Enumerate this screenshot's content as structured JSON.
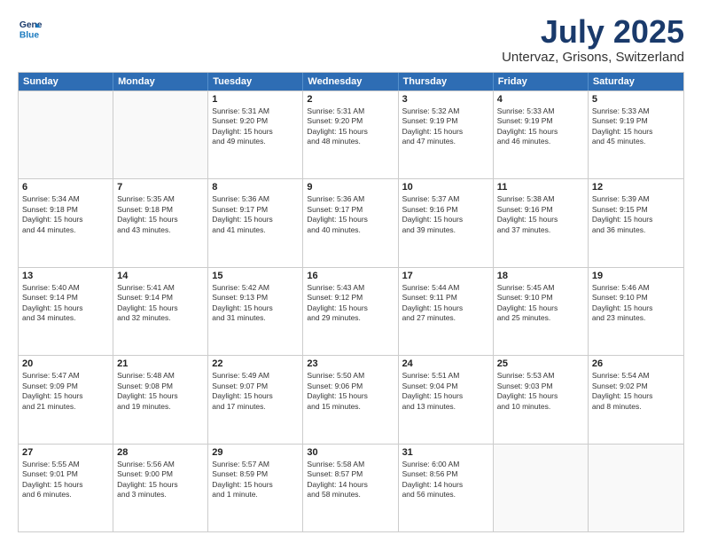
{
  "header": {
    "logo_line1": "General",
    "logo_line2": "Blue",
    "month": "July 2025",
    "location": "Untervaz, Grisons, Switzerland"
  },
  "weekdays": [
    "Sunday",
    "Monday",
    "Tuesday",
    "Wednesday",
    "Thursday",
    "Friday",
    "Saturday"
  ],
  "rows": [
    [
      {
        "day": "",
        "lines": []
      },
      {
        "day": "",
        "lines": []
      },
      {
        "day": "1",
        "lines": [
          "Sunrise: 5:31 AM",
          "Sunset: 9:20 PM",
          "Daylight: 15 hours",
          "and 49 minutes."
        ]
      },
      {
        "day": "2",
        "lines": [
          "Sunrise: 5:31 AM",
          "Sunset: 9:20 PM",
          "Daylight: 15 hours",
          "and 48 minutes."
        ]
      },
      {
        "day": "3",
        "lines": [
          "Sunrise: 5:32 AM",
          "Sunset: 9:19 PM",
          "Daylight: 15 hours",
          "and 47 minutes."
        ]
      },
      {
        "day": "4",
        "lines": [
          "Sunrise: 5:33 AM",
          "Sunset: 9:19 PM",
          "Daylight: 15 hours",
          "and 46 minutes."
        ]
      },
      {
        "day": "5",
        "lines": [
          "Sunrise: 5:33 AM",
          "Sunset: 9:19 PM",
          "Daylight: 15 hours",
          "and 45 minutes."
        ]
      }
    ],
    [
      {
        "day": "6",
        "lines": [
          "Sunrise: 5:34 AM",
          "Sunset: 9:18 PM",
          "Daylight: 15 hours",
          "and 44 minutes."
        ]
      },
      {
        "day": "7",
        "lines": [
          "Sunrise: 5:35 AM",
          "Sunset: 9:18 PM",
          "Daylight: 15 hours",
          "and 43 minutes."
        ]
      },
      {
        "day": "8",
        "lines": [
          "Sunrise: 5:36 AM",
          "Sunset: 9:17 PM",
          "Daylight: 15 hours",
          "and 41 minutes."
        ]
      },
      {
        "day": "9",
        "lines": [
          "Sunrise: 5:36 AM",
          "Sunset: 9:17 PM",
          "Daylight: 15 hours",
          "and 40 minutes."
        ]
      },
      {
        "day": "10",
        "lines": [
          "Sunrise: 5:37 AM",
          "Sunset: 9:16 PM",
          "Daylight: 15 hours",
          "and 39 minutes."
        ]
      },
      {
        "day": "11",
        "lines": [
          "Sunrise: 5:38 AM",
          "Sunset: 9:16 PM",
          "Daylight: 15 hours",
          "and 37 minutes."
        ]
      },
      {
        "day": "12",
        "lines": [
          "Sunrise: 5:39 AM",
          "Sunset: 9:15 PM",
          "Daylight: 15 hours",
          "and 36 minutes."
        ]
      }
    ],
    [
      {
        "day": "13",
        "lines": [
          "Sunrise: 5:40 AM",
          "Sunset: 9:14 PM",
          "Daylight: 15 hours",
          "and 34 minutes."
        ]
      },
      {
        "day": "14",
        "lines": [
          "Sunrise: 5:41 AM",
          "Sunset: 9:14 PM",
          "Daylight: 15 hours",
          "and 32 minutes."
        ]
      },
      {
        "day": "15",
        "lines": [
          "Sunrise: 5:42 AM",
          "Sunset: 9:13 PM",
          "Daylight: 15 hours",
          "and 31 minutes."
        ]
      },
      {
        "day": "16",
        "lines": [
          "Sunrise: 5:43 AM",
          "Sunset: 9:12 PM",
          "Daylight: 15 hours",
          "and 29 minutes."
        ]
      },
      {
        "day": "17",
        "lines": [
          "Sunrise: 5:44 AM",
          "Sunset: 9:11 PM",
          "Daylight: 15 hours",
          "and 27 minutes."
        ]
      },
      {
        "day": "18",
        "lines": [
          "Sunrise: 5:45 AM",
          "Sunset: 9:10 PM",
          "Daylight: 15 hours",
          "and 25 minutes."
        ]
      },
      {
        "day": "19",
        "lines": [
          "Sunrise: 5:46 AM",
          "Sunset: 9:10 PM",
          "Daylight: 15 hours",
          "and 23 minutes."
        ]
      }
    ],
    [
      {
        "day": "20",
        "lines": [
          "Sunrise: 5:47 AM",
          "Sunset: 9:09 PM",
          "Daylight: 15 hours",
          "and 21 minutes."
        ]
      },
      {
        "day": "21",
        "lines": [
          "Sunrise: 5:48 AM",
          "Sunset: 9:08 PM",
          "Daylight: 15 hours",
          "and 19 minutes."
        ]
      },
      {
        "day": "22",
        "lines": [
          "Sunrise: 5:49 AM",
          "Sunset: 9:07 PM",
          "Daylight: 15 hours",
          "and 17 minutes."
        ]
      },
      {
        "day": "23",
        "lines": [
          "Sunrise: 5:50 AM",
          "Sunset: 9:06 PM",
          "Daylight: 15 hours",
          "and 15 minutes."
        ]
      },
      {
        "day": "24",
        "lines": [
          "Sunrise: 5:51 AM",
          "Sunset: 9:04 PM",
          "Daylight: 15 hours",
          "and 13 minutes."
        ]
      },
      {
        "day": "25",
        "lines": [
          "Sunrise: 5:53 AM",
          "Sunset: 9:03 PM",
          "Daylight: 15 hours",
          "and 10 minutes."
        ]
      },
      {
        "day": "26",
        "lines": [
          "Sunrise: 5:54 AM",
          "Sunset: 9:02 PM",
          "Daylight: 15 hours",
          "and 8 minutes."
        ]
      }
    ],
    [
      {
        "day": "27",
        "lines": [
          "Sunrise: 5:55 AM",
          "Sunset: 9:01 PM",
          "Daylight: 15 hours",
          "and 6 minutes."
        ]
      },
      {
        "day": "28",
        "lines": [
          "Sunrise: 5:56 AM",
          "Sunset: 9:00 PM",
          "Daylight: 15 hours",
          "and 3 minutes."
        ]
      },
      {
        "day": "29",
        "lines": [
          "Sunrise: 5:57 AM",
          "Sunset: 8:59 PM",
          "Daylight: 15 hours",
          "and 1 minute."
        ]
      },
      {
        "day": "30",
        "lines": [
          "Sunrise: 5:58 AM",
          "Sunset: 8:57 PM",
          "Daylight: 14 hours",
          "and 58 minutes."
        ]
      },
      {
        "day": "31",
        "lines": [
          "Sunrise: 6:00 AM",
          "Sunset: 8:56 PM",
          "Daylight: 14 hours",
          "and 56 minutes."
        ]
      },
      {
        "day": "",
        "lines": []
      },
      {
        "day": "",
        "lines": []
      }
    ]
  ]
}
